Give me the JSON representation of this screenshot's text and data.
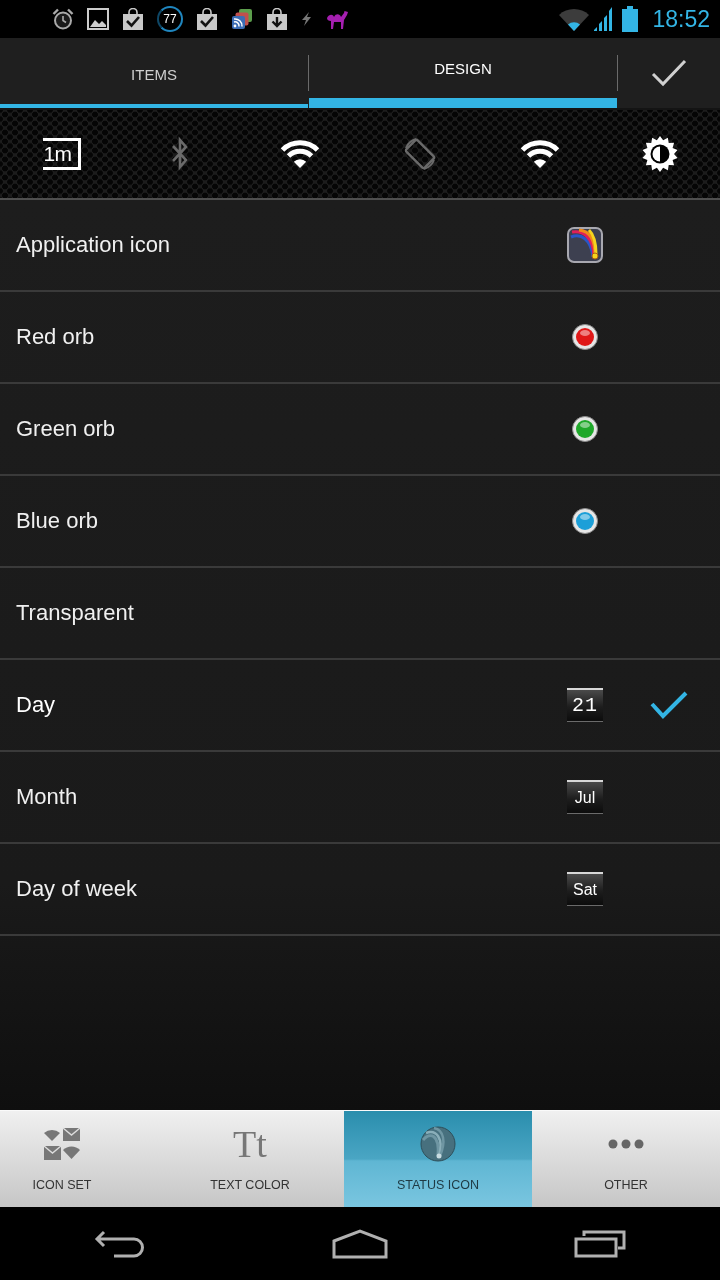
{
  "status_bar": {
    "notifications": [
      {
        "kind": "alarm"
      },
      {
        "kind": "gallery"
      },
      {
        "kind": "store_done"
      },
      {
        "kind": "counter",
        "label": "77"
      },
      {
        "kind": "store_done"
      },
      {
        "kind": "feeds"
      },
      {
        "kind": "store_download"
      },
      {
        "kind": "flash"
      },
      {
        "kind": "camel"
      }
    ],
    "time": "18:52"
  },
  "tabs": [
    {
      "label": "ITEMS",
      "selected": false
    },
    {
      "label": "DESIGN",
      "selected": true
    }
  ],
  "toggles": [
    {
      "kind": "timeout",
      "label": "1m",
      "on": true
    },
    {
      "kind": "bluetooth",
      "on": false
    },
    {
      "kind": "wifi",
      "on": true
    },
    {
      "kind": "rotation",
      "on": false
    },
    {
      "kind": "wifi",
      "on": true
    },
    {
      "kind": "brightness",
      "on": true
    }
  ],
  "options": [
    {
      "label": "Application icon",
      "kind": "app",
      "selected": false
    },
    {
      "label": "Red orb",
      "kind": "orb",
      "color": "#e01818",
      "selected": false
    },
    {
      "label": "Green orb",
      "kind": "orb",
      "color": "#1fa82a",
      "selected": false
    },
    {
      "label": "Blue orb",
      "kind": "orb",
      "color": "#1c9fd8",
      "selected": false
    },
    {
      "label": "Transparent",
      "kind": "none",
      "selected": false
    },
    {
      "label": "Day",
      "kind": "calendar",
      "preview": "21",
      "selected": true
    },
    {
      "label": "Month",
      "kind": "calendar",
      "preview": "Jul",
      "selected": false
    },
    {
      "label": "Day of week",
      "kind": "calendar",
      "preview": "Sat",
      "selected": false
    }
  ],
  "bottom_tabs": [
    {
      "kind": "icon_set",
      "label": "ICON SET",
      "selected": false
    },
    {
      "kind": "text_color",
      "glyph": "Tt",
      "label": "TEXT COLOR",
      "selected": false
    },
    {
      "kind": "status_icon",
      "label": "STATUS ICON",
      "selected": true
    },
    {
      "kind": "other",
      "label": "OTHER",
      "selected": false
    }
  ]
}
